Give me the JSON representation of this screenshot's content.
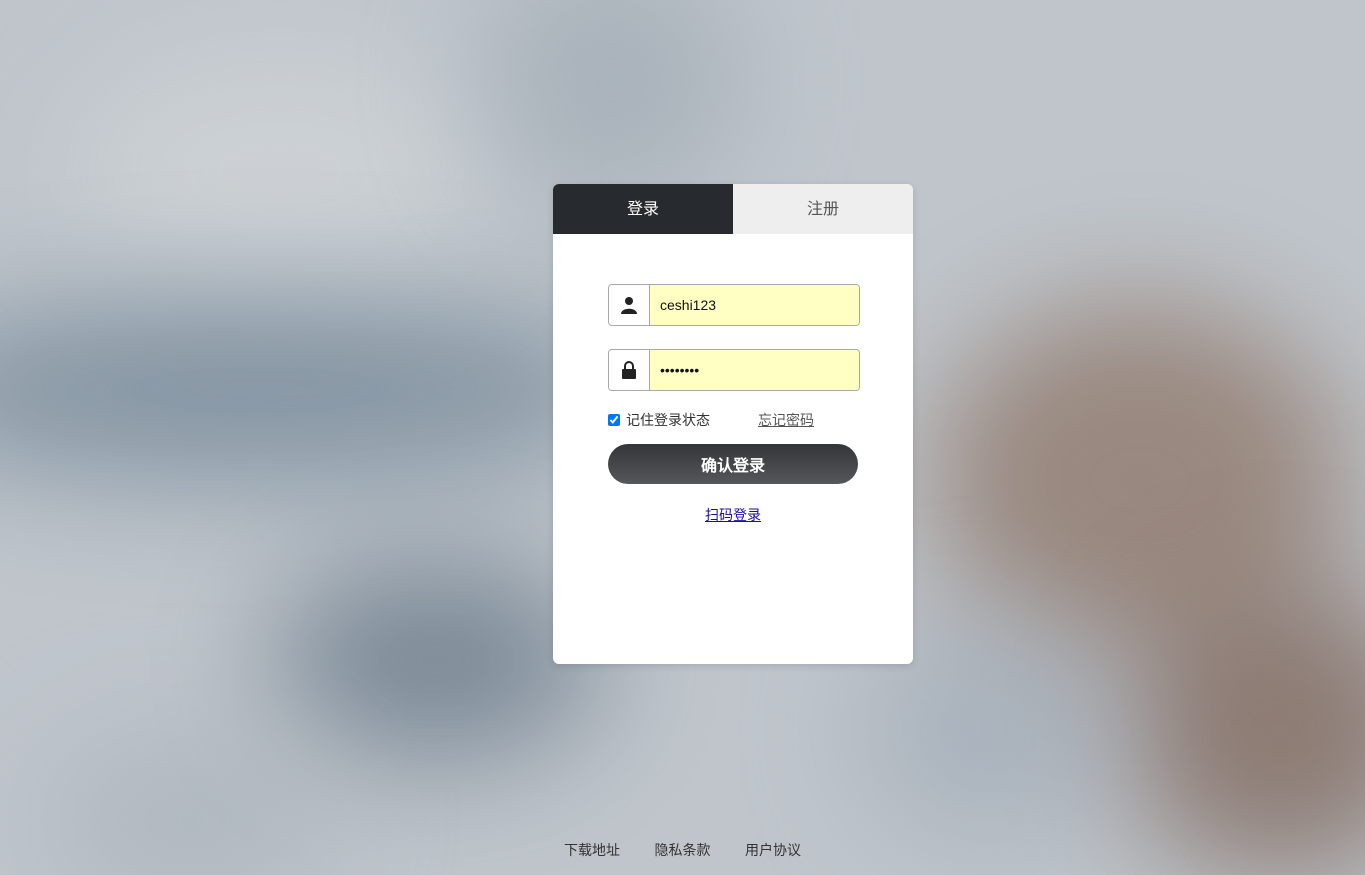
{
  "tabs": {
    "login": "登录",
    "register": "注册"
  },
  "form": {
    "username_value": "ceshi123",
    "password_value": "12345678",
    "remember_label": "记住登录状态",
    "remember_checked": true,
    "forgot_label": "忘记密码",
    "submit_label": "确认登录",
    "qr_label": "扫码登录"
  },
  "footer": [
    "下载地址",
    "隐私条款",
    "用户协议"
  ],
  "colors": {
    "tab_active": "#272a2e",
    "tab_inactive": "#eeeeee",
    "autofill": "#ffffc4",
    "link": "#1a0dab"
  }
}
